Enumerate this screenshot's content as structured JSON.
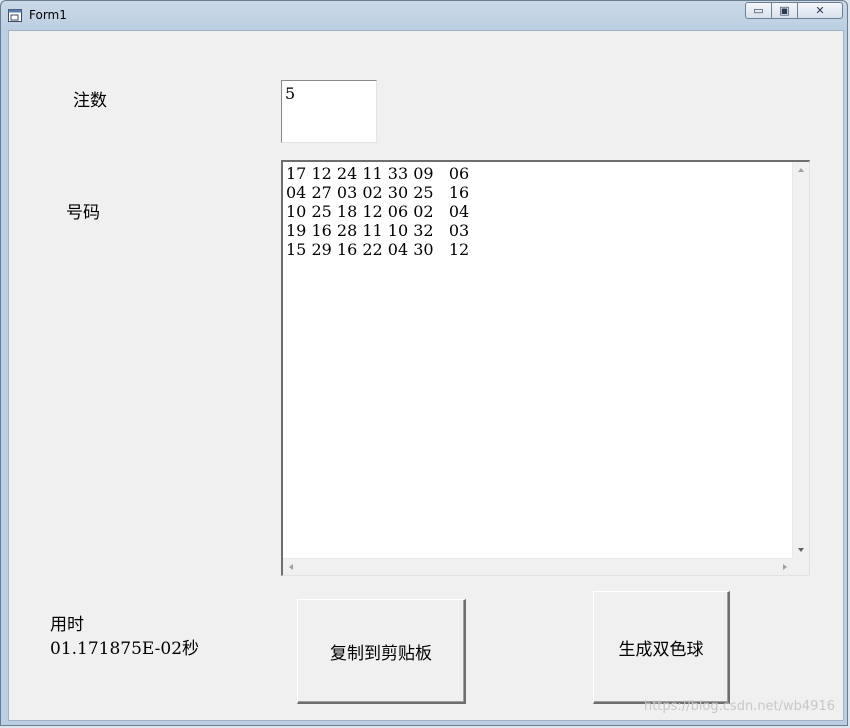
{
  "window": {
    "title": "Form1",
    "buttons": {
      "minimize": "▭",
      "maximize": "▣",
      "close": "✕"
    }
  },
  "form": {
    "count_label": "注数",
    "count_value": "5",
    "numbers_label": "号码",
    "numbers_text": "17 12 24 11 33 09   06\n04 27 03 02 30 25   16\n10 25 18 12 06 02   04\n19 16 28 11 10 32   03\n15 29 16 22 04 30   12",
    "time_label": "用时",
    "time_value": "01.171875E-02秒",
    "copy_button": "复制到剪贴板",
    "generate_button": "生成双色球"
  },
  "watermark": "https://blog.csdn.net/wb4916"
}
